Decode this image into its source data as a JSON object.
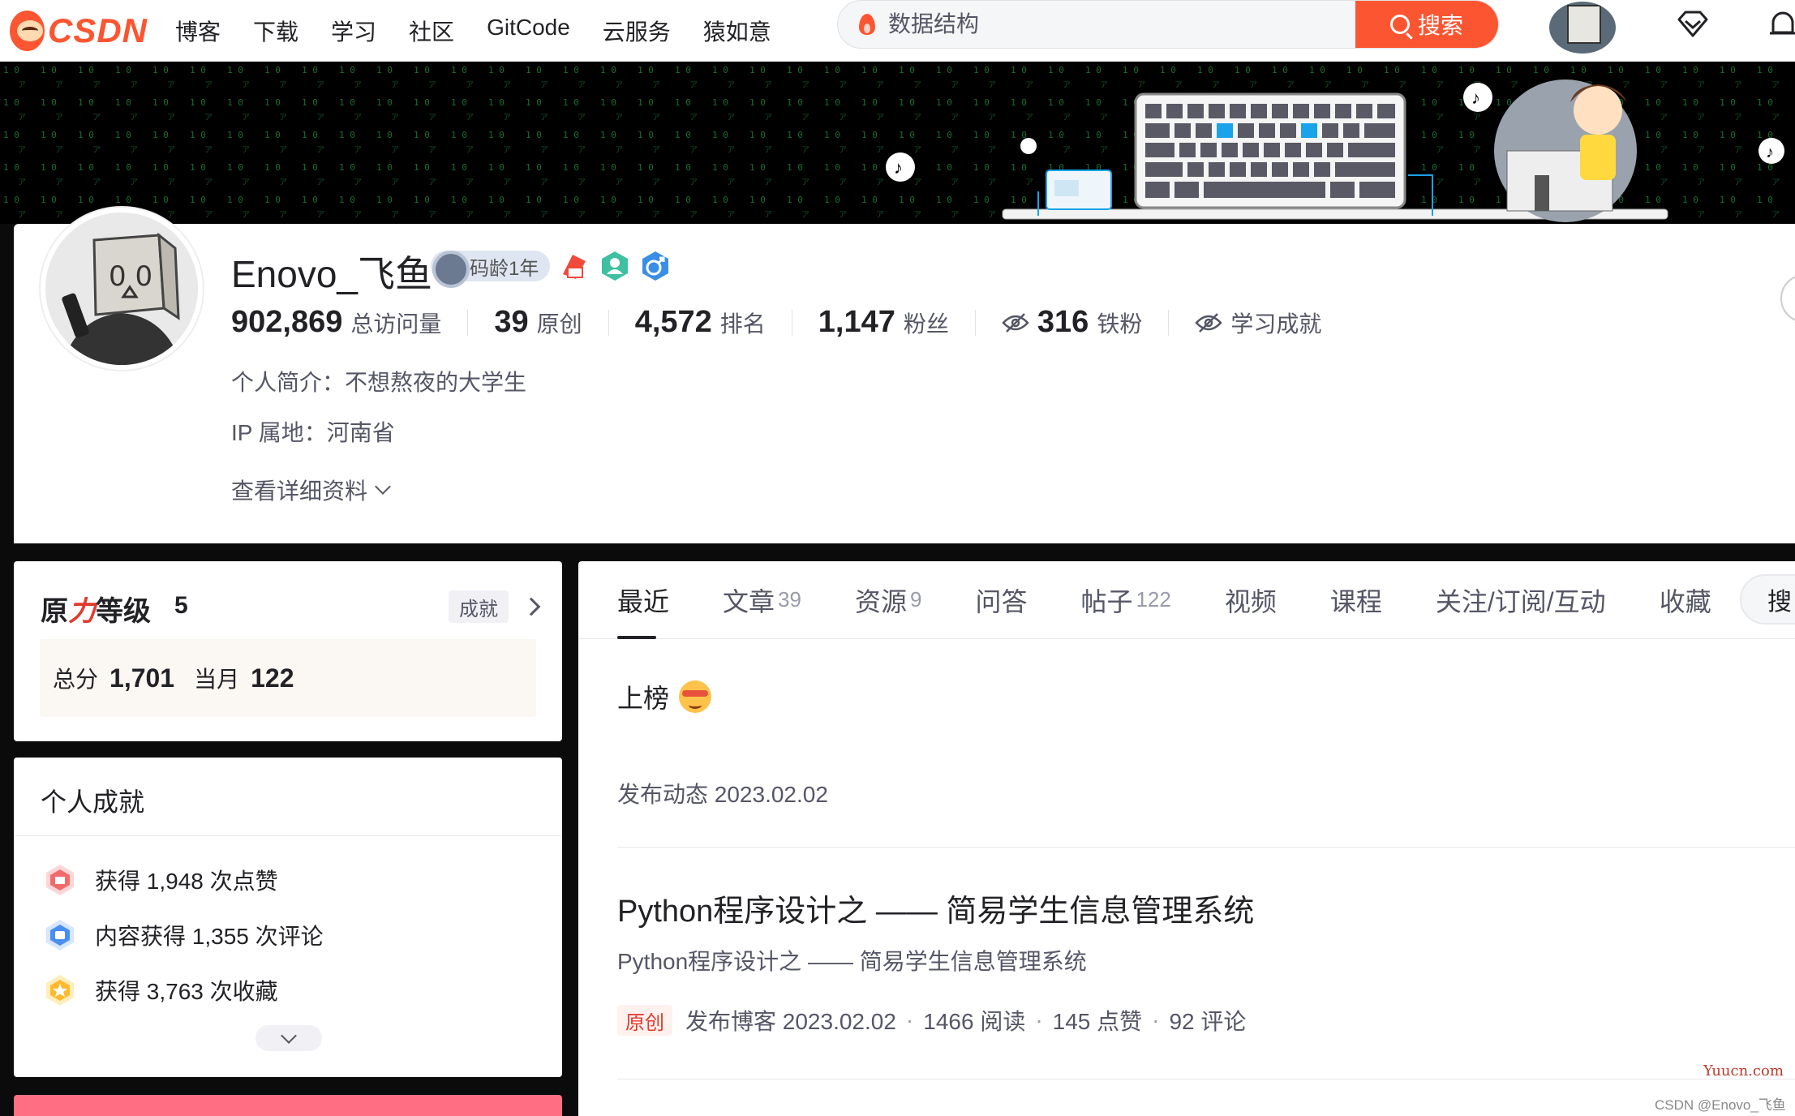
{
  "topnav": {
    "logo_text": "CSDN",
    "items": [
      "博客",
      "下载",
      "学习",
      "社区",
      "GitCode",
      "云服务",
      "猿如意"
    ],
    "search_placeholder": "数据结构",
    "search_button": "搜索"
  },
  "profile": {
    "username": "Enovo_飞鱼",
    "code_age": "码龄1年",
    "stats": [
      {
        "num": "902,869",
        "label": "总访问量"
      },
      {
        "num": "39",
        "label": "原创"
      },
      {
        "num": "4,572",
        "label": "排名"
      },
      {
        "num": "1,147",
        "label": "粉丝"
      },
      {
        "num": "316",
        "label": "铁粉"
      }
    ],
    "learning_achievement": "学习成就",
    "intro": "个人简介：不想熬夜的大学生",
    "ip": "IP 属地：河南省",
    "more": "查看详细资料"
  },
  "level_card": {
    "title_a": "原",
    "title_b": "力",
    "title_c": "等级",
    "level": "5",
    "achievement_btn": "成就",
    "total_label": "总分",
    "total": "1,701",
    "month_label": "当月",
    "month": "122"
  },
  "personal_card": {
    "title": "个人成就",
    "items": [
      "获得 1,948 次点赞",
      "内容获得 1,355 次评论",
      "获得 3,763 次收藏"
    ]
  },
  "tabs": [
    {
      "label": "最近",
      "count": ""
    },
    {
      "label": "文章",
      "count": "39"
    },
    {
      "label": "资源",
      "count": "9"
    },
    {
      "label": "问答",
      "count": ""
    },
    {
      "label": "帖子",
      "count": "122"
    },
    {
      "label": "视频",
      "count": ""
    },
    {
      "label": "课程",
      "count": ""
    },
    {
      "label": "关注/订阅/互动",
      "count": ""
    },
    {
      "label": "收藏",
      "count": ""
    }
  ],
  "tab_search": "搜",
  "feed": {
    "section_title": "上榜",
    "dynamic": "发布动态 2023.02.02",
    "article": {
      "title": "Python程序设计之 —— 简易学生信息管理系统",
      "desc": "Python程序设计之 —— 简易学生信息管理系统",
      "tag": "原创",
      "published": "发布博客 2023.02.02",
      "reads": "1466 阅读",
      "likes": "145 点赞",
      "comments": "92 评论"
    }
  },
  "watermarks": {
    "site": "Yuucn.com",
    "author": "CSDN @Enovo_飞鱼"
  },
  "colors": {
    "brand": "#fc5531",
    "text_primary": "#222226",
    "text_secondary": "#555666",
    "tag_red": "#e23a2e"
  }
}
